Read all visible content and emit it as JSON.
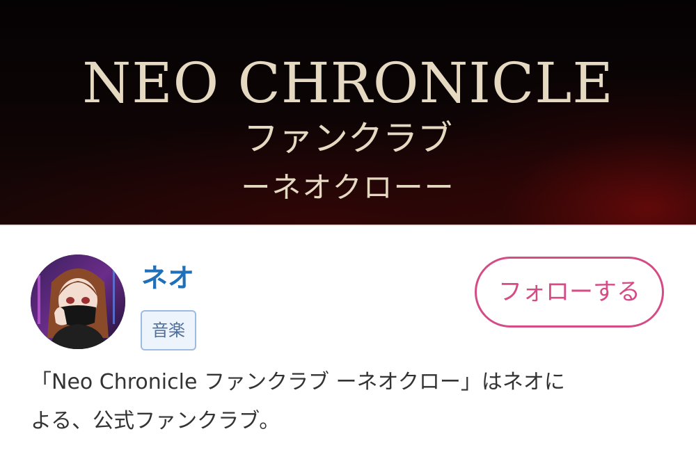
{
  "banner": {
    "title": "NEO CHRONICLE",
    "subtitle": "ファンクラブ",
    "subtitle2": "ーネオクローー"
  },
  "profile": {
    "name": "ネオ",
    "category": "音楽",
    "follow_label": "フォローする",
    "avatar_icon": "avatar-illustration"
  },
  "description": {
    "line1": "「Neo Chronicle ファンクラブ ーネオクロー」はネオに",
    "line2": "よる、公式ファンクラブ。"
  },
  "colors": {
    "name": "#1f70b8",
    "follow": "#d44b86",
    "tag_border": "#9dbbe0",
    "banner_text": "#e6d9c2"
  }
}
